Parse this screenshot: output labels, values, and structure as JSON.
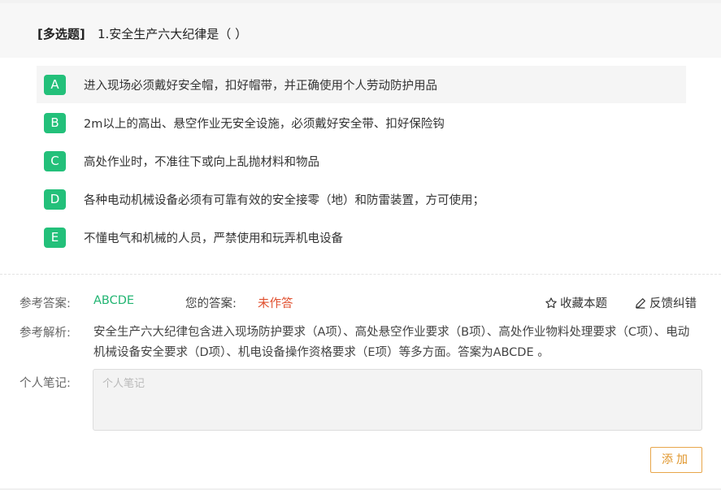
{
  "question": {
    "type_label": "[多选题]",
    "text": "1.安全生产六大纪律是（    ）"
  },
  "options": [
    {
      "letter": "A",
      "text": "进入现场必须戴好安全帽，扣好帽带，并正确使用个人劳动防护用品"
    },
    {
      "letter": "B",
      "text": "2m以上的高出、悬空作业无安全设施，必须戴好安全带、扣好保险钩"
    },
    {
      "letter": "C",
      "text": "高处作业时，不准往下或向上乱抛材料和物品"
    },
    {
      "letter": "D",
      "text": "各种电动机械设备必须有可靠有效的安全接零（地）和防雷装置，方可使用；"
    },
    {
      "letter": "E",
      "text": "不懂电气和机械的人员，严禁使用和玩弄机电设备"
    }
  ],
  "answer": {
    "reference_label": "参考答案:",
    "reference_value": "ABCDE",
    "yours_label": "您的答案:",
    "yours_value": "未作答",
    "favorite_label": "收藏本题",
    "feedback_label": "反馈纠错"
  },
  "analysis": {
    "label": "参考解析:",
    "text": "安全生产六大纪律包含进入现场防护要求（A项）、高处悬空作业要求（B项）、高处作业物料处理要求（C项）、电动机械设备安全要求（D项）、机电设备操作资格要求（E项）等多方面。答案为ABCDE 。"
  },
  "notes": {
    "label": "个人笔记:",
    "placeholder": "个人笔记",
    "value": "",
    "add_button": "添加"
  },
  "colors": {
    "option_badge": "#23c07a",
    "correct_answer": "#23b573",
    "your_answer": "#e0502f",
    "add_button": "#e0962b"
  },
  "icons": {
    "favorite": "star-outline-icon",
    "feedback": "pencil-icon"
  }
}
